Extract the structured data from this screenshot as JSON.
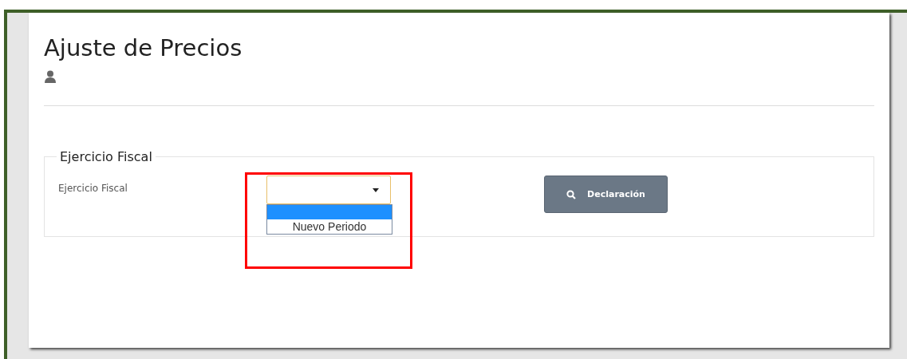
{
  "page": {
    "title": "Ajuste de Precios"
  },
  "fieldset": {
    "legend": "Ejercicio Fiscal",
    "field": {
      "label": "Ejercicio Fiscal",
      "open": true,
      "blank_option": {
        "selected": true
      },
      "options": [
        {
          "label": "Nuevo Periodo",
          "selected": false
        }
      ]
    },
    "button": {
      "label": "Declaración"
    }
  },
  "highlight": {
    "shown": true
  }
}
